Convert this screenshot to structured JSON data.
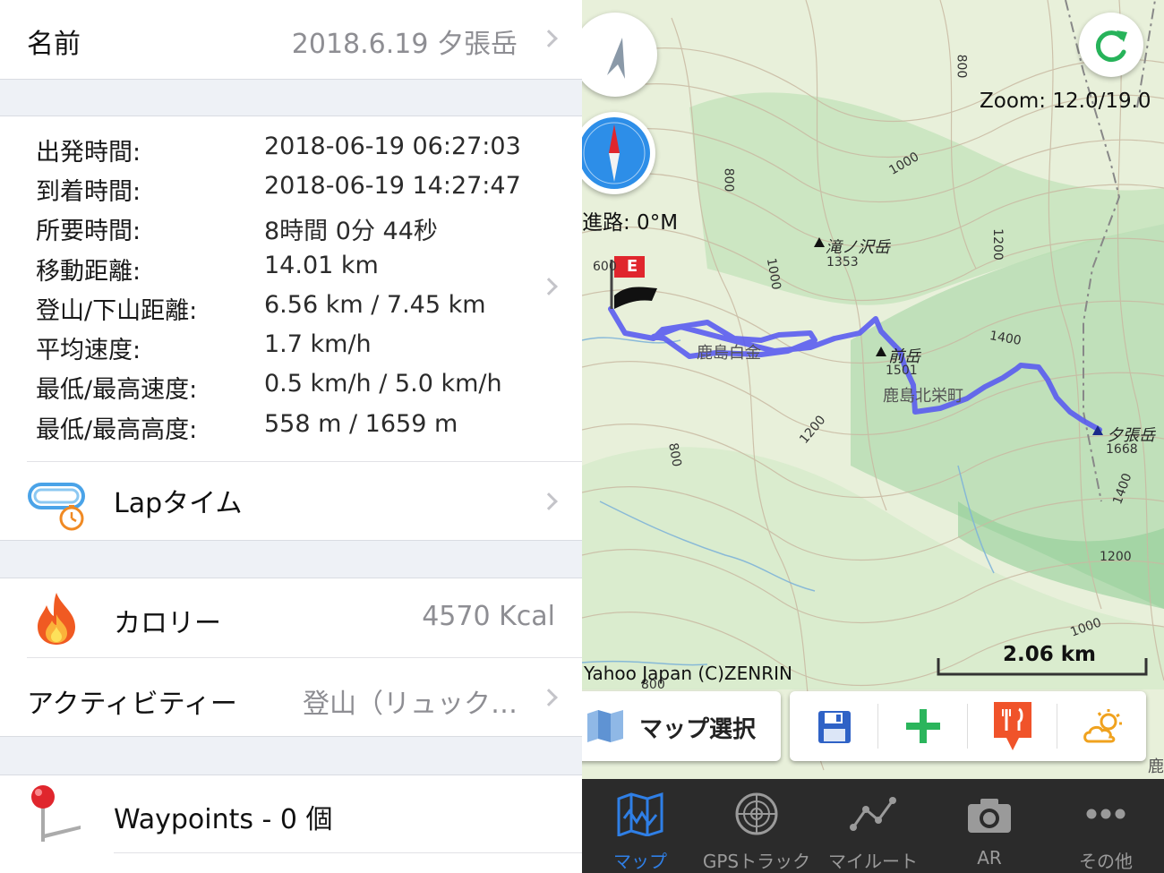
{
  "details": {
    "name_label": "名前",
    "name_value": "2018.6.19 夕張岳",
    "stats": [
      {
        "label": "出発時間:",
        "value": "2018-06-19 06:27:03"
      },
      {
        "label": "到着時間:",
        "value": "2018-06-19 14:27:47"
      },
      {
        "label": "所要時間:",
        "value": "8時間 0分 44秒"
      },
      {
        "label": "移動距離:",
        "value": "14.01 km"
      },
      {
        "label": "登山/下山距離:",
        "value": "6.56 km / 7.45 km"
      },
      {
        "label": "平均速度:",
        "value": "1.7 km/h"
      },
      {
        "label": "最低/最高速度:",
        "value": "0.5 km/h / 5.0 km/h"
      },
      {
        "label": "最低/最高高度:",
        "value": "558 m / 1659 m"
      }
    ],
    "lap_label": "Lapタイム",
    "calorie_label": "カロリー",
    "calorie_value": "4570 Kcal",
    "activity_label": "アクティビティー",
    "activity_value": "登山（リュック…",
    "waypoints_label": "Waypoints - 0 個"
  },
  "map": {
    "zoom_text": "Zoom: 12.0/19.0",
    "heading_text": "進路: 0°M",
    "attribution": "Yahoo Japan (C)ZENRIN",
    "scale_label": "2.06 km",
    "track_color": "#5a5cf0",
    "places": {
      "takinosawa": "滝ノ沢岳",
      "takinosawa_elev": "1353",
      "maedake": "前岳",
      "maedake_elev": "1501",
      "yubaridake": "夕張岳",
      "yubaridake_elev": "1668",
      "shirogane": "鹿島白金",
      "hokuei": "鹿島北栄町",
      "edge": "鹿"
    },
    "contours": [
      "800",
      "1000",
      "1000",
      "800",
      "600",
      "1200",
      "1400",
      "1200",
      "800",
      "1400",
      "1200",
      "1000",
      "800"
    ],
    "start_flag": "E",
    "map_select_label": "マップ選択"
  },
  "tabs": [
    {
      "label": "マップ",
      "active": true
    },
    {
      "label": "GPSトラック",
      "active": false
    },
    {
      "label": "マイルート",
      "active": false
    },
    {
      "label": "AR",
      "active": false
    },
    {
      "label": "その他",
      "active": false
    }
  ],
  "colors": {
    "accent": "#2f7fe6",
    "tabbar_bg": "#2b2b2b",
    "separator_bg": "#eef1f6"
  }
}
